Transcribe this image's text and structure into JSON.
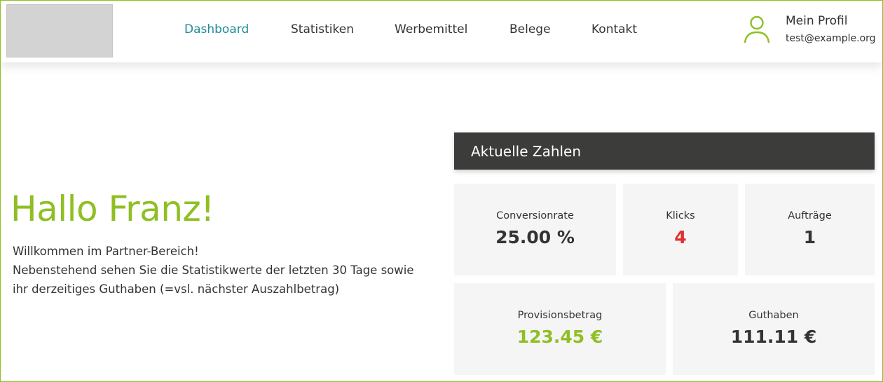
{
  "header": {
    "logo_alt": "",
    "nav": [
      {
        "label": "Dashboard",
        "active": true
      },
      {
        "label": "Statistiken",
        "active": false
      },
      {
        "label": "Werbemittel",
        "active": false
      },
      {
        "label": "Belege",
        "active": false
      },
      {
        "label": "Kontakt",
        "active": false
      }
    ],
    "profile": {
      "title": "Mein Profil",
      "email": "test@example.org",
      "icon": "user-icon"
    }
  },
  "main": {
    "greeting": "Hallo Franz!",
    "welcome_lines": [
      "Willkommen im Partner-Bereich!",
      "Nebenstehend sehen Sie die Statistikwerte der letzten 30 Tage sowie",
      "ihr derzeitiges Guthaben (=vsl. nächster Auszahlbetrag)"
    ]
  },
  "stats_panel": {
    "title": "Aktuelle Zahlen",
    "stats": [
      {
        "label": "Conversionrate",
        "value": "25.00 %",
        "color": "#333333"
      },
      {
        "label": "Klicks",
        "value": "4",
        "color": "#e03131"
      },
      {
        "label": "Aufträge",
        "value": "1",
        "color": "#333333"
      },
      {
        "label": "Provisionsbetrag",
        "value": "123.45 €",
        "color": "#8fbf24"
      },
      {
        "label": "Guthaben",
        "value": "111.11 €",
        "color": "#333333"
      }
    ]
  },
  "colors": {
    "accent_green": "#8fbf24",
    "nav_active": "#1e8c96",
    "panel_header_bg": "#3c3c3b",
    "card_bg": "#f5f5f5"
  }
}
